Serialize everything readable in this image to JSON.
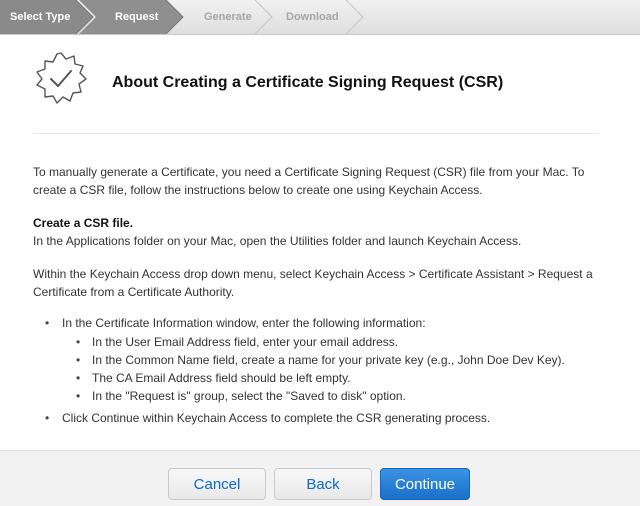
{
  "steps": [
    {
      "label": "Select Type"
    },
    {
      "label": "Request"
    },
    {
      "label": "Generate"
    },
    {
      "label": "Download"
    }
  ],
  "header": {
    "icon": "certificate-badge-icon",
    "title": "About Creating a Certificate Signing Request (CSR)"
  },
  "content": {
    "intro": "To manually generate a Certificate, you need a Certificate Signing Request (CSR) file from your Mac. To create a CSR file, follow the instructions below to create one using Keychain Access.",
    "heading": "Create a CSR file.",
    "apps_text": "In the Applications folder on your Mac, open the Utilities folder and launch Keychain Access.",
    "keychain_text": "Within the Keychain Access drop down menu, select Keychain Access > Certificate Assistant > Request a Certificate from a Certificate Authority.",
    "bullet1": "In the Certificate Information window, enter the following information:",
    "sub": [
      "In the User Email Address field, enter your email address.",
      "In the Common Name field, create a name for your private key (e.g., John Doe Dev Key).",
      "The CA Email Address field should be left empty.",
      "In the \"Request is\" group, select the \"Saved to disk\" option."
    ],
    "bullet2": "Click Continue within Keychain Access to complete the CSR generating process."
  },
  "footer": {
    "cancel": "Cancel",
    "back": "Back",
    "continue": "Continue"
  },
  "colors": {
    "active_step": "#8c8c8c",
    "primary": "#1a6fcb",
    "link": "#0a68c9"
  }
}
